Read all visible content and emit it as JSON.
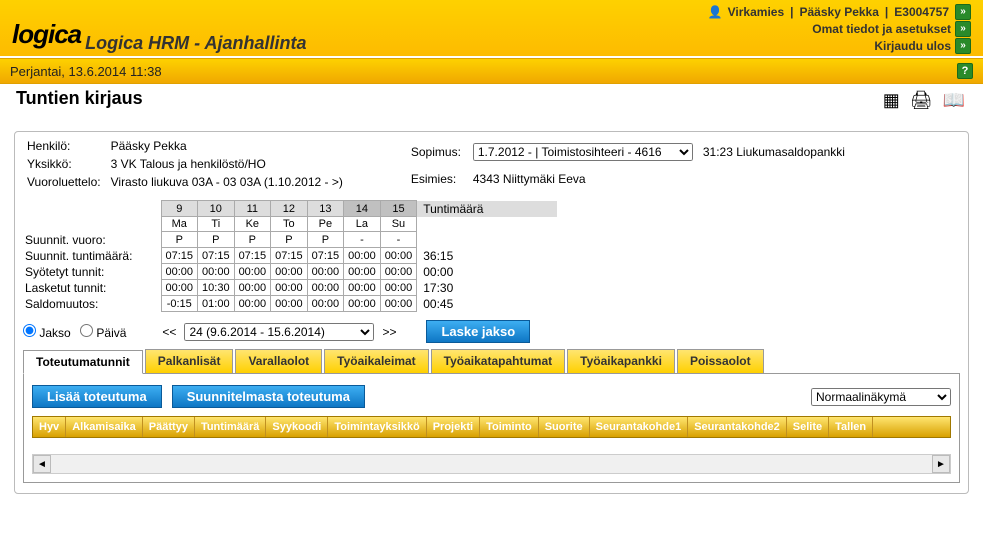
{
  "header": {
    "logo_text": "logica",
    "app_title": "Logica  HRM - Ajanhallinta",
    "user_role": "Virkamies",
    "user_name": "Pääsky Pekka",
    "user_code": "E3004757",
    "settings_label": "Omat tiedot ja asetukset",
    "logout_label": "Kirjaudu ulos"
  },
  "datebar": {
    "text": "Perjantai, 13.6.2014 11:38"
  },
  "page": {
    "title": "Tuntien kirjaus"
  },
  "info": {
    "person_label": "Henkilö:",
    "person_value": "Pääsky Pekka",
    "unit_label": "Yksikkö:",
    "unit_value": "3 VK Talous ja henkilöstö/HO",
    "roster_label": "Vuoroluettelo:",
    "roster_value": "Virasto liukuva 03A - 03 03A (1.10.2012 - >)",
    "contract_label": "Sopimus:",
    "contract_value": "1.7.2012 - | Toimistosihteeri - 4616",
    "supervisor_label": "Esimies:",
    "supervisor_value": "4343 Niittymäki Eeva",
    "balance_info": "31:23 Liukumasaldopankki"
  },
  "week": {
    "days": [
      "9",
      "10",
      "11",
      "12",
      "13",
      "14",
      "15"
    ],
    "weekdays": [
      "Ma",
      "Ti",
      "Ke",
      "To",
      "Pe",
      "La",
      "Su"
    ],
    "rows": {
      "planned_shift_label": "Suunnit. vuoro:",
      "planned_shift": [
        "P",
        "P",
        "P",
        "P",
        "P",
        "-",
        "-"
      ],
      "planned_hours_label": "Suunnit. tuntimäärä:",
      "planned_hours": [
        "07:15",
        "07:15",
        "07:15",
        "07:15",
        "07:15",
        "00:00",
        "00:00"
      ],
      "entered_label": "Syötetyt tunnit:",
      "entered": [
        "00:00",
        "00:00",
        "00:00",
        "00:00",
        "00:00",
        "00:00",
        "00:00"
      ],
      "calculated_label": "Lasketut tunnit:",
      "calculated": [
        "00:00",
        "10:30",
        "00:00",
        "00:00",
        "00:00",
        "00:00",
        "00:00"
      ],
      "balance_label": "Saldomuutos:",
      "balance": [
        "-0:15",
        "01:00",
        "00:00",
        "00:00",
        "00:00",
        "00:00",
        "00:00"
      ]
    },
    "totals_label": "Tuntimäärä",
    "totals": [
      "36:15",
      "00:00",
      "17:30",
      "00:45"
    ]
  },
  "period": {
    "jakso_label": "Jakso",
    "paiva_label": "Päivä",
    "prev": "<<",
    "next": ">>",
    "select_value": "24 (9.6.2014 - 15.6.2014)",
    "calc_button": "Laske jakso"
  },
  "tabs": [
    "Toteutumatunnit",
    "Palkanlisät",
    "Varallaolot",
    "Työaikaleimat",
    "Työaikatapahtumat",
    "Työaikapankki",
    "Poissaolot"
  ],
  "panel": {
    "add_button": "Lisää toteutuma",
    "from_plan_button": "Suunnitelmasta toteutuma",
    "view_select": "Normaalinäkymä",
    "columns": [
      "Hyv",
      "Alkamisaika",
      "Päättyy",
      "Tuntimäärä",
      "Syykoodi",
      "Toimintayksikkö",
      "Projekti",
      "Toiminto",
      "Suorite",
      "Seurantakohde1",
      "Seurantakohde2",
      "Selite",
      "Tallen"
    ]
  }
}
